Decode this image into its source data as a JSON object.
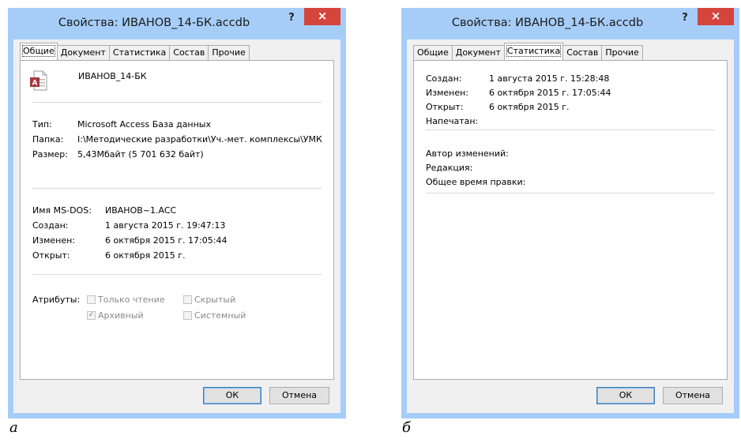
{
  "dialog_a": {
    "title": "Свойства: ИВАНОВ_14-БК.accdb",
    "help_label": "?",
    "close_label": "×",
    "tabs": [
      "Общие",
      "Документ",
      "Статистика",
      "Состав",
      "Прочие"
    ],
    "active_tab": "Общие",
    "file_name": "ИВАНОВ_14-БК",
    "type_label": "Тип:",
    "type_value": "Microsoft Access База данных",
    "folder_label": "Папка:",
    "folder_value": "I:\\Методические разработки\\Уч.-мет. комплексы\\УМК",
    "size_label": "Размер:",
    "size_value": "5,43Мбайт (5 701 632 байт)",
    "msdos_label": "Имя MS-DOS:",
    "msdos_value": "ИВАНОВ~1.ACC",
    "created_label": "Создан:",
    "created_value": "1 августа 2015 г. 19:47:13",
    "modified_label": "Изменен:",
    "modified_value": "6 октября 2015 г. 17:05:44",
    "opened_label": "Открыт:",
    "opened_value": "6 октября 2015 г.",
    "attributes_label": "Атрибуты:",
    "readonly_label": "Только чтение",
    "hidden_label": "Скрытый",
    "archive_label": "Архивный",
    "system_label": "Системный",
    "archive_check": "✓",
    "ok_label": "ОК",
    "cancel_label": "Отмена"
  },
  "dialog_b": {
    "title": "Свойства: ИВАНОВ_14-БК.accdb",
    "help_label": "?",
    "close_label": "×",
    "tabs": [
      "Общие",
      "Документ",
      "Статистика",
      "Состав",
      "Прочие"
    ],
    "active_tab": "Статистика",
    "created_label": "Создан:",
    "created_value": "1 августа 2015 г. 15:28:48",
    "modified_label": "Изменен:",
    "modified_value": "6 октября 2015 г. 17:05:44",
    "opened_label": "Открыт:",
    "opened_value": "6 октября 2015 г.",
    "printed_label": "Напечатан:",
    "author_label": "Автор изменений:",
    "revision_label": "Редакция:",
    "total_edit_label": "Общее время правки:",
    "ok_label": "ОК",
    "cancel_label": "Отмена"
  },
  "captions": {
    "a": "а",
    "b": "б"
  },
  "colors": {
    "window_frame": "#a6cdf7",
    "close_button": "#d4453c",
    "access_icon": "#a4373a"
  },
  "icons": {
    "file": "access-file-icon"
  }
}
